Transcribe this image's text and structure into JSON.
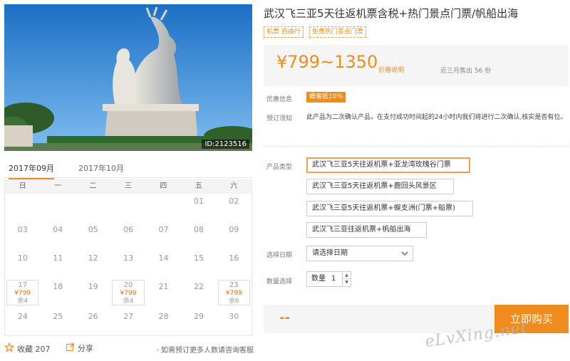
{
  "product": {
    "title": "武汉飞三亚5天往返机票含税+热门景点门票/帆船出海",
    "tags": [
      "机票 自由行",
      "免费热门景点门票"
    ],
    "image_id": "ID:2123516"
  },
  "price": {
    "range": "¥799~1350",
    "note": "价格说明",
    "sold": "近三月售出 56 份"
  },
  "discount": {
    "label": "优惠信息",
    "badge": "蜂蜜抵10%"
  },
  "booking": {
    "label": "预订须知",
    "text": "此产品为二次确认产品，在支付成功时间起的24小时内我们将进行二次确认,核实是否有位。"
  },
  "product_type": {
    "label": "产品类型",
    "options": [
      "武汉飞三亚5天往返机票+亚龙湾玫瑰谷门票",
      "武汉飞三亚5天往返机票+鹿回头风景区",
      "武汉飞三亚5天往返机票+蜈支洲(门票+船票)",
      "武汉飞三亚往返机票+帆船出海"
    ],
    "selected_index": 0
  },
  "date_select": {
    "label": "选择日期",
    "placeholder": "请选择日期"
  },
  "quantity": {
    "label": "数量选择",
    "prefix": "数量",
    "value": "1"
  },
  "buy": {
    "total": "--",
    "button": "立即购买"
  },
  "calendar": {
    "tabs": [
      "2017年09月",
      "2017年10月"
    ],
    "active_tab": 0,
    "weekdays": [
      "日",
      "一",
      "二",
      "三",
      "四",
      "五",
      "六"
    ],
    "days": [
      {
        "day": "01",
        "col": 5,
        "row": 0
      },
      {
        "day": "02",
        "col": 6,
        "row": 0
      },
      {
        "day": "03",
        "col": 0,
        "row": 1
      },
      {
        "day": "04",
        "col": 1,
        "row": 1
      },
      {
        "day": "05",
        "col": 2,
        "row": 1
      },
      {
        "day": "06",
        "col": 3,
        "row": 1
      },
      {
        "day": "07",
        "col": 4,
        "row": 1
      },
      {
        "day": "08",
        "col": 5,
        "row": 1
      },
      {
        "day": "09",
        "col": 6,
        "row": 1
      },
      {
        "day": "10",
        "col": 0,
        "row": 2
      },
      {
        "day": "11",
        "col": 1,
        "row": 2
      },
      {
        "day": "12",
        "col": 2,
        "row": 2
      },
      {
        "day": "13",
        "col": 3,
        "row": 2
      },
      {
        "day": "14",
        "col": 4,
        "row": 2
      },
      {
        "day": "15",
        "col": 5,
        "row": 2
      },
      {
        "day": "16",
        "col": 6,
        "row": 2
      },
      {
        "day": "17",
        "col": 0,
        "row": 3,
        "price": "¥799",
        "remain": "余4"
      },
      {
        "day": "18",
        "col": 1,
        "row": 3
      },
      {
        "day": "19",
        "col": 2,
        "row": 3
      },
      {
        "day": "20",
        "col": 3,
        "row": 3,
        "price": "¥799",
        "remain": "余4"
      },
      {
        "day": "21",
        "col": 4,
        "row": 3
      },
      {
        "day": "22",
        "col": 5,
        "row": 3
      },
      {
        "day": "23",
        "col": 6,
        "row": 3,
        "price": "¥799",
        "remain": "余6"
      },
      {
        "day": "24",
        "col": 0,
        "row": 4
      },
      {
        "day": "25",
        "col": 1,
        "row": 4
      },
      {
        "day": "26",
        "col": 2,
        "row": 4
      },
      {
        "day": "27",
        "col": 3,
        "row": 4
      },
      {
        "day": "28",
        "col": 4,
        "row": 4
      },
      {
        "day": "29",
        "col": 5,
        "row": 4
      },
      {
        "day": "30",
        "col": 6,
        "row": 4
      }
    ]
  },
  "footer": {
    "favorite": "收藏 207",
    "share": "分享",
    "consult": "· 如需预订更多人数请咨询客服"
  },
  "watermark": "eLvXing.net",
  "colors": {
    "accent": "#f08c1e",
    "panel_bg": "#f5f5f5"
  },
  "icons": {
    "favorite": "star-icon",
    "share": "share-icon",
    "date": "chevron-down-icon"
  }
}
